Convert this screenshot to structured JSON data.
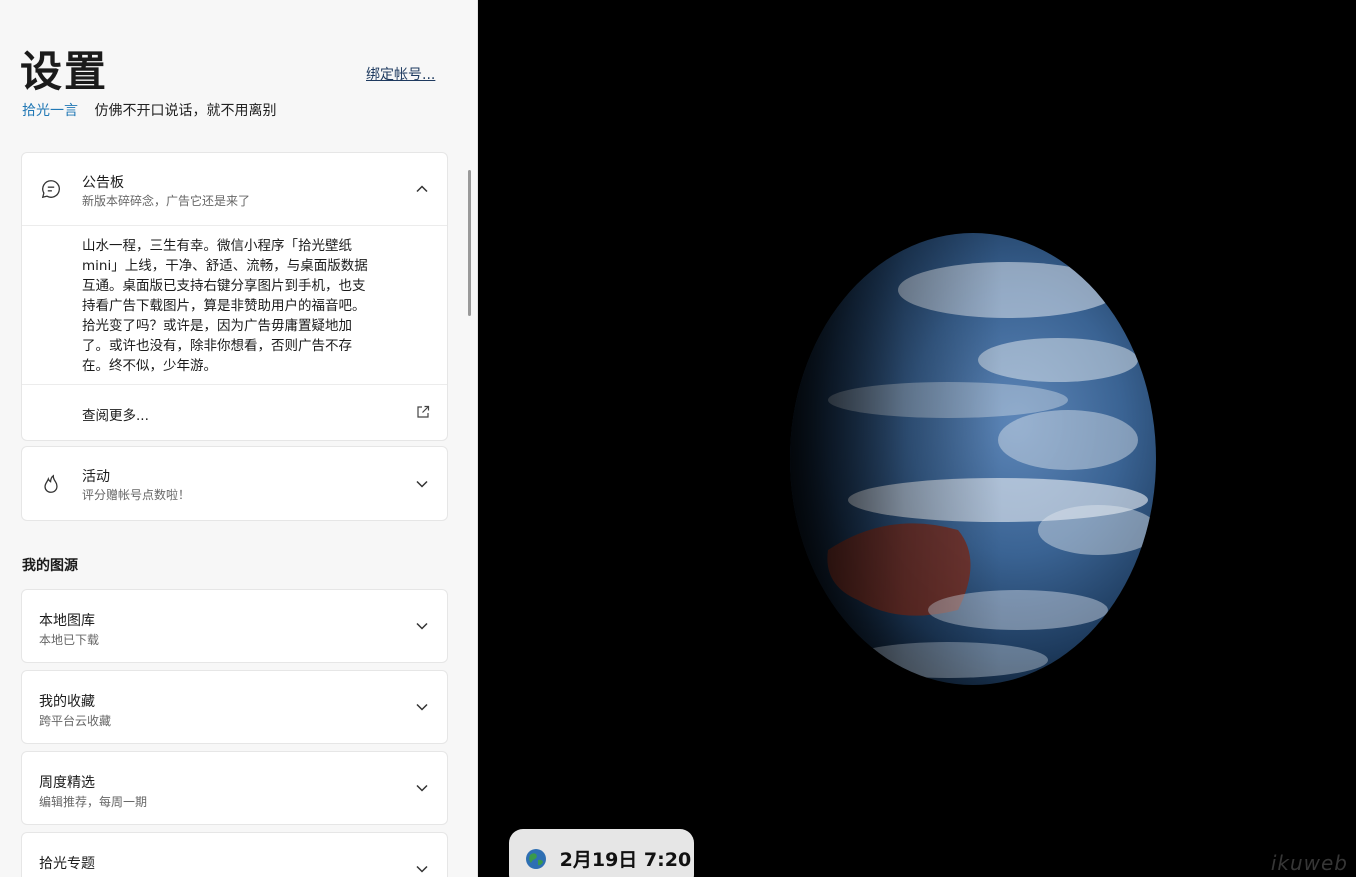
{
  "page": {
    "title": "设置",
    "bind_account": "绑定帐号...",
    "quote_source": "拾光一言",
    "quote_text": "仿佛不开口说话，就不用离别"
  },
  "notice": {
    "title": "公告板",
    "subtitle": "新版本碎碎念，广告它还是来了",
    "icon": "chat-bubble-icon",
    "lines": [
      "山水一程，三生有幸。微信小程序「拾光壁纸",
      "mini」上线，干净、舒适、流畅，与桌面版数据",
      "互通。桌面版已支持右键分享图片到手机，也支",
      "持看广告下载图片，算是非赞助用户的福音吧。",
      "拾光变了吗？或许是，因为广告毋庸置疑地加",
      "了。或许也没有，除非你想看，否则广告不存",
      "在。终不似，少年游。"
    ],
    "more_label": "查阅更多..."
  },
  "activity": {
    "title": "活动",
    "subtitle": "评分赠帐号点数啦！",
    "icon": "flame-icon"
  },
  "sources": {
    "heading": "我的图源",
    "items": [
      {
        "title": "本地图库",
        "subtitle": "本地已下载"
      },
      {
        "title": "我的收藏",
        "subtitle": "跨平台云收藏"
      },
      {
        "title": "周度精选",
        "subtitle": "编辑推荐，每周一期"
      },
      {
        "title": "拾光专题",
        "subtitle": ""
      }
    ]
  },
  "wallpaper": {
    "date": "2月19日",
    "time": "7:20",
    "watermark": "ikuweb"
  },
  "colors": {
    "accent": "#2178b5",
    "panel_bg": "#f7f7f7",
    "card_bg": "#ffffff",
    "wall_bg": "#000000",
    "pill_bg": "#e6e6e6"
  }
}
